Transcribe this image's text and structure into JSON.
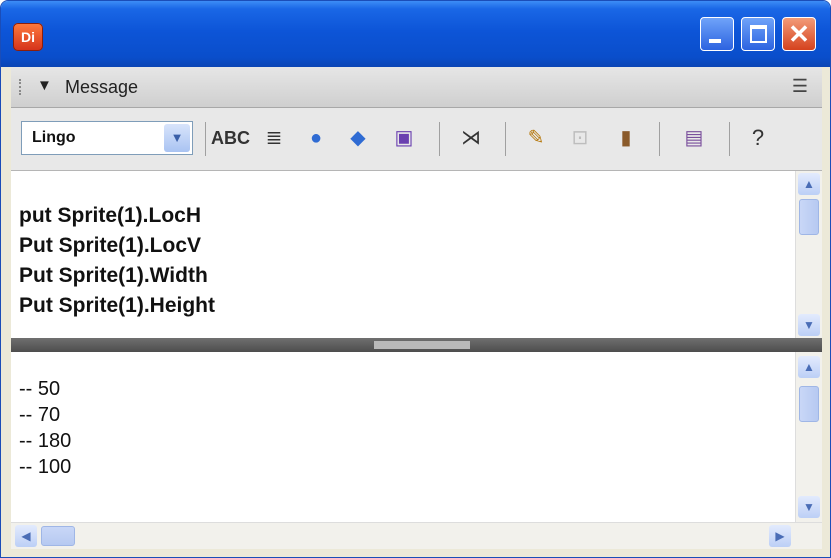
{
  "window": {
    "app_icon_label": "Di",
    "controls": {
      "minimize": "minimize",
      "maximize": "maximize",
      "close": "close"
    }
  },
  "panel": {
    "title": "Message",
    "collapse_icon": "triangle-down-icon",
    "options_icon": "panel-options-icon"
  },
  "toolbar": {
    "language_select": {
      "value": "Lingo"
    },
    "icons": [
      "alphabetical-lingo-icon",
      "categorized-lingo-icon",
      "scripting-objects-icon",
      "3d-lingo-icon",
      "scripting-xtras-icon",
      "trace-icon",
      "watch-expression-icon",
      "inspect-object-icon",
      "cast-member-script-icon",
      "clear-icon",
      "help-icon"
    ]
  },
  "script_pane": {
    "lines": [
      "put Sprite(1).LocH",
      "Put Sprite(1).LocV",
      "Put Sprite(1).Width",
      "Put Sprite(1).Height"
    ]
  },
  "output_pane": {
    "lines": [
      "-- 50",
      "-- 70",
      "-- 180",
      "-- 100"
    ]
  },
  "colors": {
    "titlebar": "#0a4ecb",
    "close_button": "#d5421e",
    "splitter": "#4d4d4d"
  }
}
